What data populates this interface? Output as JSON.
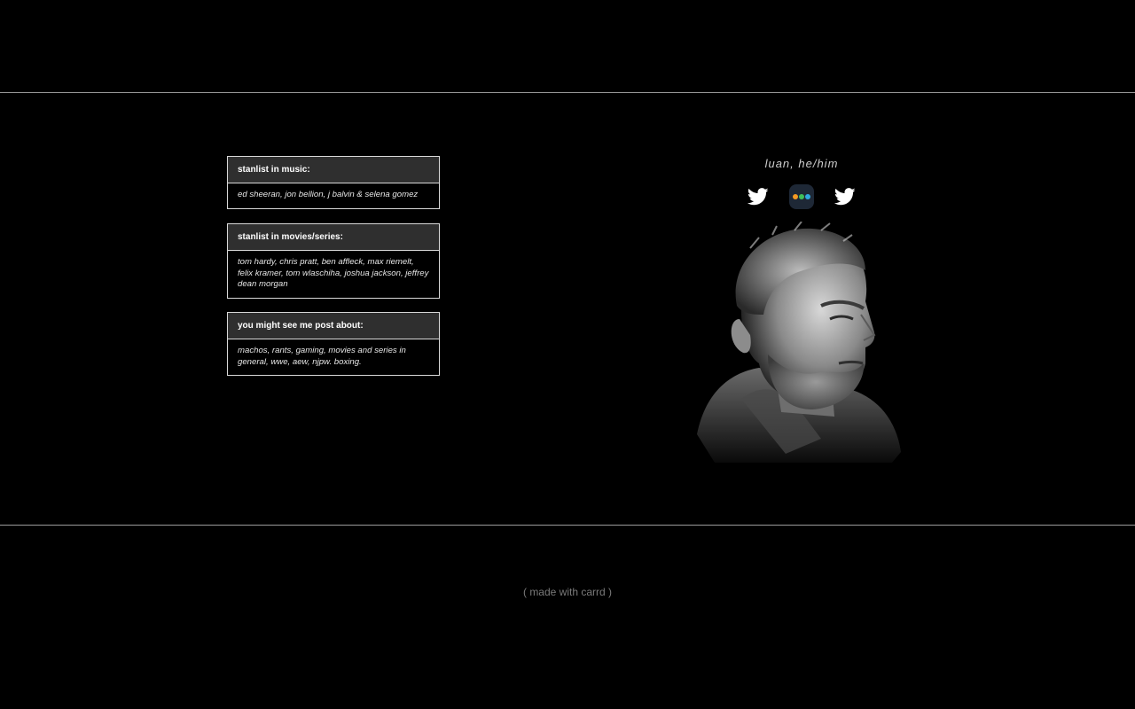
{
  "sections": [
    {
      "title": "stanlist in music:",
      "body": "ed sheeran, jon bellion, j balvin & selena gomez"
    },
    {
      "title": "stanlist in movies/series:",
      "body": "tom hardy, chris pratt, ben affleck, max riemelt, felix kramer, tom wlaschiha, joshua jackson, jeffrey dean morgan"
    },
    {
      "title": "you might see me post about:",
      "body": "machos, rants, gaming, movies and series in general, wwe, aew, njpw. boxing."
    }
  ],
  "profile": {
    "name": "luan, he/him",
    "icons": [
      "twitter-icon",
      "dots-app-icon",
      "twitter-icon"
    ]
  },
  "footer": {
    "credit": "( made with carrd )"
  },
  "colors": {
    "background": "#000000",
    "box_header": "#2f2f2f",
    "box_border": "#d9d9d9",
    "rule": "#9a9a9a",
    "dot_orange": "#f59a23",
    "dot_green": "#3fbf5a",
    "dot_blue": "#2fa8e0"
  }
}
